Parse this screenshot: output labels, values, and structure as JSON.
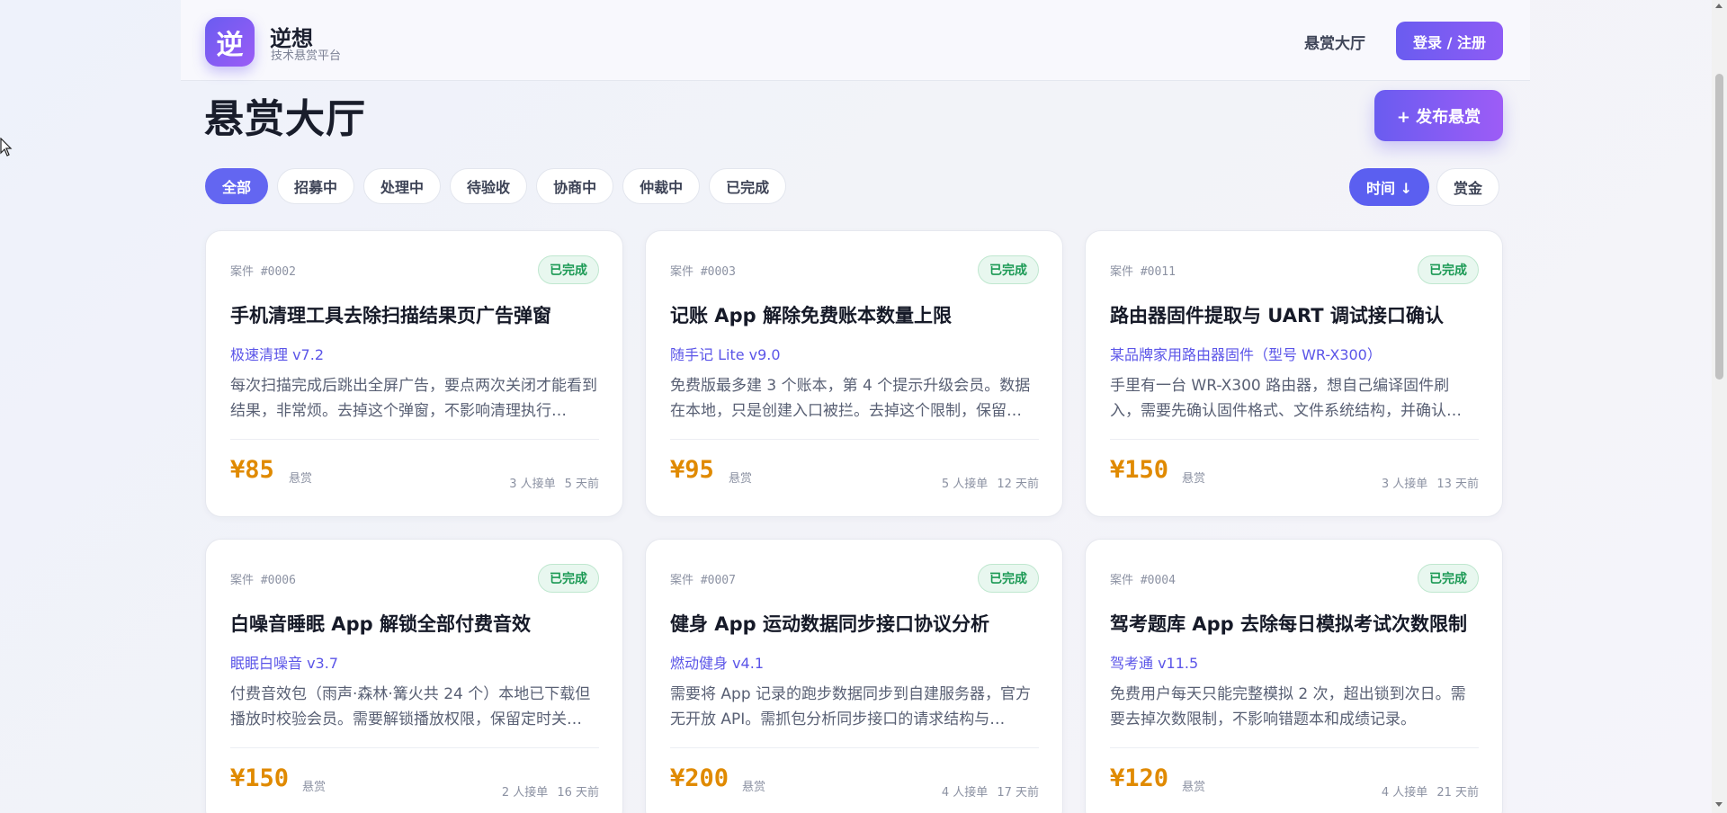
{
  "header": {
    "logo_char": "逆",
    "brand_name": "逆想",
    "brand_sub": "技术悬赏平台",
    "nav_link": "悬赏大厅",
    "login_label": "登录 / 注册"
  },
  "page": {
    "title": "悬赏大厅",
    "publish_label": "+ 发布悬赏"
  },
  "filters": [
    "全部",
    "招募中",
    "处理中",
    "待验收",
    "协商中",
    "仲裁中",
    "已完成"
  ],
  "active_filter": "全部",
  "sorts": [
    "时间 ↓",
    "赏金"
  ],
  "active_sort": "时间 ↓",
  "colors": {
    "accent": "#6366f1",
    "reward": "#e08a00",
    "status_done": "#1c9a55"
  },
  "cards": [
    {
      "case_no": "案件 #0002",
      "status": "已完成",
      "title": "手机清理工具去除扫描结果页广告弹窗",
      "product": "极速清理 v7.2",
      "desc": "每次扫描完成后跳出全屏广告，要点两次关闭才能看到结果，非常烦。去掉这个弹窗，不影响清理执行…",
      "reward": "¥85",
      "reward_label": "悬赏",
      "takers": "3 人接单",
      "days": "5 天前"
    },
    {
      "case_no": "案件 #0003",
      "status": "已完成",
      "title": "记账 App 解除免费账本数量上限",
      "product": "随手记 Lite v9.0",
      "desc": "免费版最多建 3 个账本，第 4 个提示升级会员。数据在本地，只是创建入口被拦。去掉这个限制，保留…",
      "reward": "¥95",
      "reward_label": "悬赏",
      "takers": "5 人接单",
      "days": "12 天前"
    },
    {
      "case_no": "案件 #0011",
      "status": "已完成",
      "title": "路由器固件提取与 UART 调试接口确认",
      "product": "某品牌家用路由器固件（型号 WR-X300）",
      "desc": "手里有一台 WR-X300 路由器，想自己编译固件刷入，需要先确认固件格式、文件系统结构，并确认…",
      "reward": "¥150",
      "reward_label": "悬赏",
      "takers": "3 人接单",
      "days": "13 天前"
    },
    {
      "case_no": "案件 #0006",
      "status": "已完成",
      "title": "白噪音睡眠 App 解锁全部付费音效",
      "product": "眠眠白噪音 v3.7",
      "desc": "付费音效包（雨声·森林·篝火共 24 个）本地已下载但播放时校验会员。需要解锁播放权限，保留定时关…",
      "reward": "¥150",
      "reward_label": "悬赏",
      "takers": "2 人接单",
      "days": "16 天前"
    },
    {
      "case_no": "案件 #0007",
      "status": "已完成",
      "title": "健身 App 运动数据同步接口协议分析",
      "product": "燃动健身 v4.1",
      "desc": "需要将 App 记录的跑步数据同步到自建服务器，官方无开放 API。需抓包分析同步接口的请求结构与…",
      "reward": "¥200",
      "reward_label": "悬赏",
      "takers": "4 人接单",
      "days": "17 天前"
    },
    {
      "case_no": "案件 #0004",
      "status": "已完成",
      "title": "驾考题库 App 去除每日模拟考试次数限制",
      "product": "驾考通 v11.5",
      "desc": "免费用户每天只能完整模拟 2 次，超出锁到次日。需要去掉次数限制，不影响错题本和成绩记录。",
      "reward": "¥120",
      "reward_label": "悬赏",
      "takers": "4 人接单",
      "days": "21 天前"
    }
  ]
}
